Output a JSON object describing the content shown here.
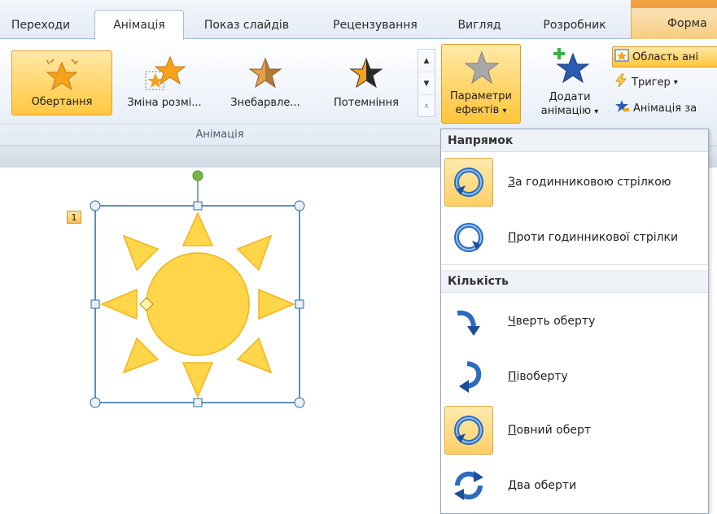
{
  "tabs": [
    {
      "label": "Переходи"
    },
    {
      "label": "Анімація",
      "active": true
    },
    {
      "label": "Показ слайдів"
    },
    {
      "label": "Рецензування"
    },
    {
      "label": "Вигляд"
    },
    {
      "label": "Розробник"
    },
    {
      "label": "Форма"
    }
  ],
  "ribbon": {
    "group_label": "Анімація",
    "gallery": [
      {
        "label": "Обертання",
        "icon": "spin-star-icon",
        "selected": true
      },
      {
        "label": "Зміна розмі...",
        "icon": "grow-star-icon"
      },
      {
        "label": "Знебарвле...",
        "icon": "desaturate-star-icon"
      },
      {
        "label": "Потемніння",
        "icon": "darken-star-icon"
      }
    ],
    "effects_button": {
      "line1": "Параметри",
      "line2": "ефектів",
      "caret": "▾"
    },
    "add_button": {
      "line1": "Додати",
      "line2": "анімацію",
      "caret": "▾"
    },
    "small_buttons": [
      {
        "label": "Область ані",
        "icon": "animation-pane-icon"
      },
      {
        "label": "Тригер",
        "caret": "▾",
        "icon": "trigger-icon"
      },
      {
        "label": "Анімація за",
        "icon": "animation-painter-icon"
      }
    ]
  },
  "slide": {
    "animation_tag": "1",
    "shape": "sun",
    "colors": {
      "fill": "#ffd54a",
      "stroke": "#f3b51b",
      "handle": "#2e6c9e",
      "rotate_handle": "#7ab648"
    }
  },
  "dropdown": {
    "sections": [
      {
        "header": "Напрямок",
        "items": [
          {
            "label": "За годинниковою стрілкою",
            "hotkey": "З",
            "rest": "а годинниковою стрілкою",
            "icon": "clockwise-icon",
            "checked": true
          },
          {
            "label": "Проти годинникової стрілки",
            "hotkey": "П",
            "rest": "роти годинникової стрілки",
            "icon": "counterclockwise-icon",
            "checked": false
          }
        ]
      },
      {
        "header": "Кількість",
        "items": [
          {
            "label": "Чверть оберту",
            "hotkey": "Ч",
            "rest": "верть оберту",
            "icon": "quarter-spin-icon",
            "checked": false
          },
          {
            "label": "Півоберту",
            "hotkey": "П",
            "rest": "івоберту",
            "icon": "half-spin-icon",
            "checked": false
          },
          {
            "label": "Повний оберт",
            "hotkey": "П",
            "rest": "овний оберт",
            "icon": "full-spin-icon",
            "checked": true
          },
          {
            "label": "Два оберти",
            "hotkey": "Д",
            "rest": "ва оберти",
            "icon": "two-spins-icon",
            "checked": false
          }
        ]
      }
    ]
  }
}
